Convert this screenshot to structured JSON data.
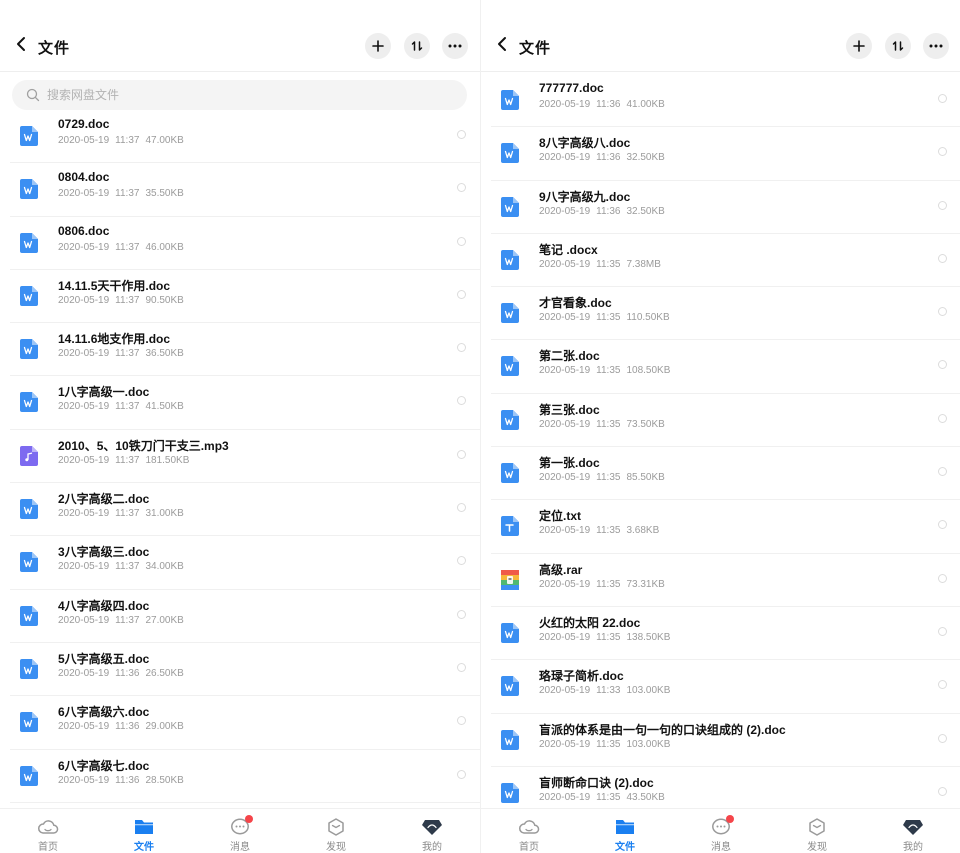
{
  "colors": {
    "accent": "#1a7ff0",
    "doc_icon": "#3b8ff2",
    "txt_icon": "#3b8ff2",
    "mp3_icon": "#7d6af0",
    "badge": "#f5454a"
  },
  "screens": [
    {
      "header": {
        "title": "文件"
      },
      "search": {
        "placeholder": "搜索网盘文件"
      },
      "files": [
        {
          "name": "0729.doc",
          "date": "2020-05-19",
          "time": "11:37",
          "size": "47.00KB",
          "icon": "word-icon"
        },
        {
          "name": "0804.doc",
          "date": "2020-05-19",
          "time": "11:37",
          "size": "35.50KB",
          "icon": "word-icon"
        },
        {
          "name": "0806.doc",
          "date": "2020-05-19",
          "time": "11:37",
          "size": "46.00KB",
          "icon": "word-icon"
        },
        {
          "name": "14.11.5天干作用.doc",
          "date": "2020-05-19",
          "time": "11:37",
          "size": "90.50KB",
          "icon": "word-icon"
        },
        {
          "name": "14.11.6地支作用.doc",
          "date": "2020-05-19",
          "time": "11:37",
          "size": "36.50KB",
          "icon": "word-icon"
        },
        {
          "name": "1八字高级一.doc",
          "date": "2020-05-19",
          "time": "11:37",
          "size": "41.50KB",
          "icon": "word-icon"
        },
        {
          "name": "2010、5、10铁刀门干支三.mp3",
          "date": "2020-05-19",
          "time": "11:37",
          "size": "181.50KB",
          "icon": "music-icon"
        },
        {
          "name": "2八字高级二.doc",
          "date": "2020-05-19",
          "time": "11:37",
          "size": "31.00KB",
          "icon": "word-icon"
        },
        {
          "name": "3八字高级三.doc",
          "date": "2020-05-19",
          "time": "11:37",
          "size": "34.00KB",
          "icon": "word-icon"
        },
        {
          "name": "4八字高级四.doc",
          "date": "2020-05-19",
          "time": "11:37",
          "size": "27.00KB",
          "icon": "word-icon"
        },
        {
          "name": "5八字高级五.doc",
          "date": "2020-05-19",
          "time": "11:36",
          "size": "26.50KB",
          "icon": "word-icon"
        },
        {
          "name": "6八字高级六.doc",
          "date": "2020-05-19",
          "time": "11:36",
          "size": "29.00KB",
          "icon": "word-icon"
        },
        {
          "name": "6八字高级七.doc",
          "date": "2020-05-19",
          "time": "11:36",
          "size": "28.50KB",
          "icon": "word-icon"
        }
      ],
      "tabs": [
        {
          "label": "首页",
          "icon": "cloud-icon",
          "active": false,
          "badge": false
        },
        {
          "label": "文件",
          "icon": "folder-icon",
          "active": true,
          "badge": false
        },
        {
          "label": "消息",
          "icon": "chat-icon",
          "active": false,
          "badge": true
        },
        {
          "label": "发现",
          "icon": "discover-icon",
          "active": false,
          "badge": false
        },
        {
          "label": "我的",
          "icon": "profile-icon",
          "active": false,
          "badge": false
        }
      ]
    },
    {
      "header": {
        "title": "文件"
      },
      "files": [
        {
          "name": "777777.doc",
          "date": "2020-05-19",
          "time": "11:36",
          "size": "41.00KB",
          "icon": "word-icon"
        },
        {
          "name": "8八字高级八.doc",
          "date": "2020-05-19",
          "time": "11:36",
          "size": "32.50KB",
          "icon": "word-icon"
        },
        {
          "name": "9八字高级九.doc",
          "date": "2020-05-19",
          "time": "11:36",
          "size": "32.50KB",
          "icon": "word-icon"
        },
        {
          "name": "笔记 .docx",
          "date": "2020-05-19",
          "time": "11:35",
          "size": "7.38MB",
          "icon": "word-icon"
        },
        {
          "name": "才官看象.doc",
          "date": "2020-05-19",
          "time": "11:35",
          "size": "110.50KB",
          "icon": "word-icon"
        },
        {
          "name": "第二张.doc",
          "date": "2020-05-19",
          "time": "11:35",
          "size": "108.50KB",
          "icon": "word-icon"
        },
        {
          "name": "第三张.doc",
          "date": "2020-05-19",
          "time": "11:35",
          "size": "73.50KB",
          "icon": "word-icon"
        },
        {
          "name": "第一张.doc",
          "date": "2020-05-19",
          "time": "11:35",
          "size": "85.50KB",
          "icon": "word-icon"
        },
        {
          "name": "定位.txt",
          "date": "2020-05-19",
          "time": "11:35",
          "size": "3.68KB",
          "icon": "text-icon"
        },
        {
          "name": "高级.rar",
          "date": "2020-05-19",
          "time": "11:35",
          "size": "73.31KB",
          "icon": "archive-icon"
        },
        {
          "name": "火红的太阳 22.doc",
          "date": "2020-05-19",
          "time": "11:35",
          "size": "138.50KB",
          "icon": "word-icon"
        },
        {
          "name": "珞琭子简析.doc",
          "date": "2020-05-19",
          "time": "11:33",
          "size": "103.00KB",
          "icon": "word-icon"
        },
        {
          "name": "盲派的体系是由一句一句的口诀组成的 (2).doc",
          "date": "2020-05-19",
          "time": "11:35",
          "size": "103.00KB",
          "icon": "word-icon"
        },
        {
          "name": "盲师断命口诀 (2).doc",
          "date": "2020-05-19",
          "time": "11:35",
          "size": "43.50KB",
          "icon": "word-icon"
        }
      ],
      "tabs": [
        {
          "label": "首页",
          "icon": "cloud-icon",
          "active": false,
          "badge": false
        },
        {
          "label": "文件",
          "icon": "folder-icon",
          "active": true,
          "badge": false
        },
        {
          "label": "消息",
          "icon": "chat-icon",
          "active": false,
          "badge": true
        },
        {
          "label": "发现",
          "icon": "discover-icon",
          "active": false,
          "badge": false
        },
        {
          "label": "我的",
          "icon": "profile-icon",
          "active": false,
          "badge": false
        }
      ]
    }
  ]
}
